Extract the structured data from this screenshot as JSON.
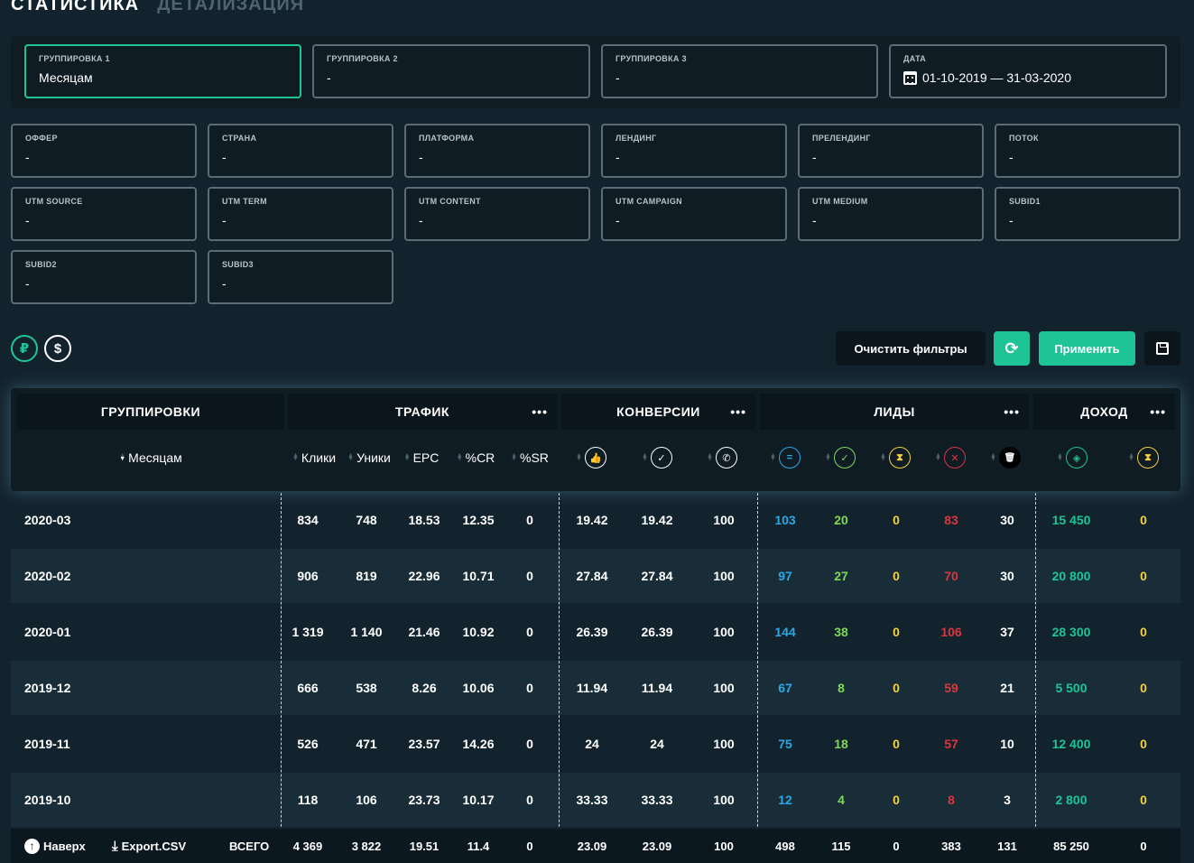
{
  "tabs": {
    "statistics": "СТАТИСТИКА",
    "details": "ДЕТАЛИЗАЦИЯ"
  },
  "groupings": [
    {
      "label": "ГРУППИРОВКА 1",
      "value": "Месяцам"
    },
    {
      "label": "ГРУППИРОВКА 2",
      "value": "-"
    },
    {
      "label": "ГРУППИРОВКА 3",
      "value": "-"
    },
    {
      "label": "ДАТА",
      "value": "01-10-2019 — 31-03-2020"
    }
  ],
  "filters": [
    {
      "label": "ОФФЕР",
      "value": "-"
    },
    {
      "label": "СТРАНА",
      "value": "-"
    },
    {
      "label": "ПЛАТФОРМА",
      "value": "-"
    },
    {
      "label": "ЛЕНДИНГ",
      "value": "-"
    },
    {
      "label": "ПРЕЛЕНДИНГ",
      "value": "-"
    },
    {
      "label": "ПОТОК",
      "value": "-"
    },
    {
      "label": "UTM SOURCE",
      "value": "-"
    },
    {
      "label": "UTM TERM",
      "value": "-"
    },
    {
      "label": "UTM CONTENT",
      "value": "-"
    },
    {
      "label": "UTM CAMPAIGN",
      "value": "-"
    },
    {
      "label": "UTM MEDIUM",
      "value": "-"
    },
    {
      "label": "SUBID1",
      "value": "-"
    },
    {
      "label": "SUBID2",
      "value": "-"
    },
    {
      "label": "SUBID3",
      "value": "-"
    }
  ],
  "currency": {
    "rub": "₽",
    "usd": "$"
  },
  "actions": {
    "clear": "Очистить фильтры",
    "refresh": "⟳",
    "apply": "Применить"
  },
  "table": {
    "groups": {
      "groupings": "ГРУППИРОВКИ",
      "traffic": "ТРАФИК",
      "conversions": "КОНВЕРСИИ",
      "leads": "ЛИДЫ",
      "income": "ДОХОД",
      "more": "•••"
    },
    "columns": {
      "month": "Месяцам",
      "clicks": "Клики",
      "uniques": "Уники",
      "epc": "EPC",
      "cr": "%CR",
      "sr": "%SR"
    },
    "icons": {
      "conv_approve": "👍",
      "conv_check": "✓",
      "conv_call": "✆",
      "lead_total": "=",
      "lead_approved": "✓",
      "lead_hold": "⧗",
      "lead_rejected": "✕",
      "lead_trash": "🗑",
      "income_paid": "◈",
      "income_hold": "⧗"
    },
    "rows": [
      {
        "period": "2020-03",
        "clicks": "834",
        "uniques": "748",
        "epc": "18.53",
        "cr": "12.35",
        "sr": "0",
        "c1": "19.42",
        "c2": "19.42",
        "c3": "100",
        "l_total": "103",
        "l_appr": "20",
        "l_hold": "0",
        "l_rej": "83",
        "l_trash": "30",
        "inc": "15 450",
        "inc_hold": "0"
      },
      {
        "period": "2020-02",
        "clicks": "906",
        "uniques": "819",
        "epc": "22.96",
        "cr": "10.71",
        "sr": "0",
        "c1": "27.84",
        "c2": "27.84",
        "c3": "100",
        "l_total": "97",
        "l_appr": "27",
        "l_hold": "0",
        "l_rej": "70",
        "l_trash": "30",
        "inc": "20 800",
        "inc_hold": "0"
      },
      {
        "period": "2020-01",
        "clicks": "1 319",
        "uniques": "1 140",
        "epc": "21.46",
        "cr": "10.92",
        "sr": "0",
        "c1": "26.39",
        "c2": "26.39",
        "c3": "100",
        "l_total": "144",
        "l_appr": "38",
        "l_hold": "0",
        "l_rej": "106",
        "l_trash": "37",
        "inc": "28 300",
        "inc_hold": "0"
      },
      {
        "period": "2019-12",
        "clicks": "666",
        "uniques": "538",
        "epc": "8.26",
        "cr": "10.06",
        "sr": "0",
        "c1": "11.94",
        "c2": "11.94",
        "c3": "100",
        "l_total": "67",
        "l_appr": "8",
        "l_hold": "0",
        "l_rej": "59",
        "l_trash": "21",
        "inc": "5 500",
        "inc_hold": "0"
      },
      {
        "period": "2019-11",
        "clicks": "526",
        "uniques": "471",
        "epc": "23.57",
        "cr": "14.26",
        "sr": "0",
        "c1": "24",
        "c2": "24",
        "c3": "100",
        "l_total": "75",
        "l_appr": "18",
        "l_hold": "0",
        "l_rej": "57",
        "l_trash": "10",
        "inc": "12 400",
        "inc_hold": "0"
      },
      {
        "period": "2019-10",
        "clicks": "118",
        "uniques": "106",
        "epc": "23.73",
        "cr": "10.17",
        "sr": "0",
        "c1": "33.33",
        "c2": "33.33",
        "c3": "100",
        "l_total": "12",
        "l_appr": "4",
        "l_hold": "0",
        "l_rej": "8",
        "l_trash": "3",
        "inc": "2 800",
        "inc_hold": "0"
      }
    ],
    "footer": {
      "to_top": "Наверх",
      "export": "Export.CSV",
      "total_label": "ВСЕГО",
      "clicks": "4 369",
      "uniques": "3 822",
      "epc": "19.51",
      "cr": "11.4",
      "sr": "0",
      "c1": "23.09",
      "c2": "23.09",
      "c3": "100",
      "l_total": "498",
      "l_appr": "115",
      "l_hold": "0",
      "l_rej": "383",
      "l_trash": "131",
      "inc": "85 250",
      "inc_hold": "0"
    }
  },
  "colors": {
    "accent": "#1fc496",
    "blue": "#2aa8e8",
    "green": "#7ed957",
    "yellow": "#f4d03f",
    "red": "#d9363e"
  }
}
